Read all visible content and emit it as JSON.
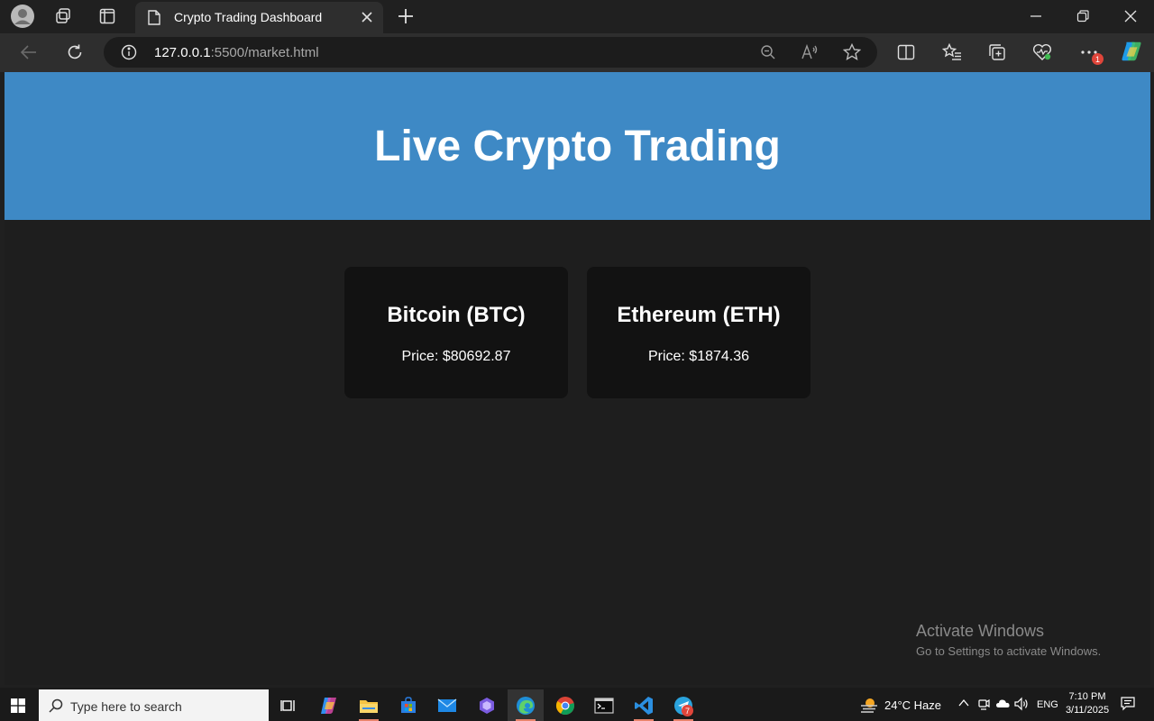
{
  "browser": {
    "tab_title": "Crypto Trading Dashboard",
    "url_host": "127.0.0.1",
    "url_rest": ":5500/market.html"
  },
  "page": {
    "heading": "Live Crypto Trading",
    "cards": [
      {
        "name": "Bitcoin (BTC)",
        "price": "Price: $80692.87"
      },
      {
        "name": "Ethereum (ETH)",
        "price": "Price: $1874.36"
      }
    ],
    "colors": {
      "header_bg": "#3e89c5",
      "page_bg": "#1e1e1e",
      "card_bg": "#121212"
    }
  },
  "watermark": {
    "title": "Activate Windows",
    "subtitle": "Go to Settings to activate Windows."
  },
  "taskbar": {
    "search_placeholder": "Type here to search",
    "weather": "24°C  Haze",
    "language": "ENG",
    "time": "7:10 PM",
    "date": "3/11/2025",
    "telegram_badge": "7",
    "menu_badge": "1",
    "apps": [
      "task-view",
      "copilot",
      "file-explorer",
      "microsoft-store",
      "mail",
      "bing",
      "edge",
      "chrome",
      "terminal",
      "vscode",
      "telegram"
    ]
  }
}
